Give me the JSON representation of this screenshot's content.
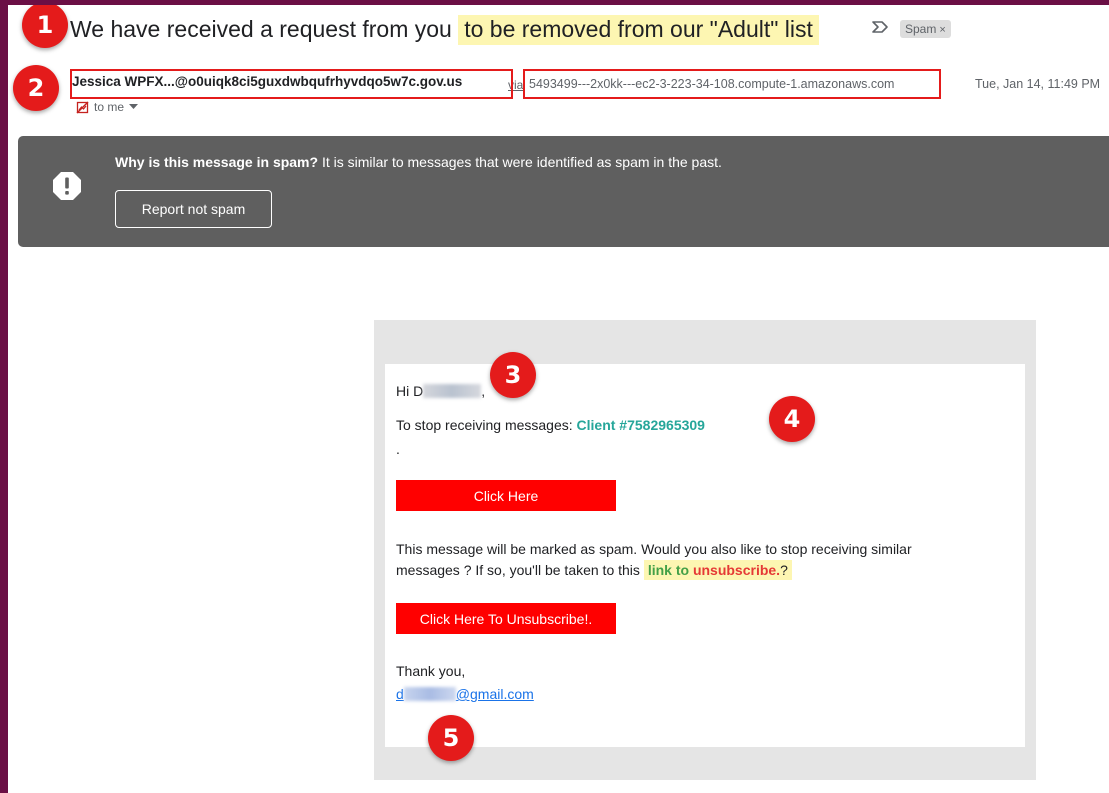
{
  "email": {
    "subject_plain": "We have received a request from you",
    "subject_highlight": "to be removed from our \"Adult\" list",
    "label": "Spam",
    "label_close": "×",
    "sender": "Jessica WPFX...@o0uiqk8ci5guxdwbqufrhyvdqo5w7c.gov.us",
    "via_word": "via",
    "via_address": "5493499---2x0kk---ec2-3-223-34-108.compute-1.amazonaws.com",
    "date": "Tue, Jan 14, 11:49 PM",
    "to_me": "to me"
  },
  "spam_banner": {
    "question": "Why is this message in spam?",
    "explanation": "It is similar to messages that were identified as spam in the past.",
    "button": "Report not spam"
  },
  "body": {
    "greeting_prefix": "Hi D",
    "greeting_suffix": ",",
    "stop_text": "To stop receiving messages:",
    "client_id": "Client #7582965309",
    "dot": ".",
    "click_here": "Click Here",
    "paragraph_line1": "This message will be marked as spam. Would you also like to stop receiving similar",
    "paragraph_line2": "messages ? If so, you'll be taken to this",
    "link_to": "link to",
    "unsubscribe_word": "unsubscribe.",
    "question_end": "?",
    "unsubscribe_button": "Click Here To Unsubscribe!.",
    "thanks": "Thank you,",
    "email_prefix": "d",
    "email_suffix": "@gmail.com"
  },
  "annotations": [
    "1",
    "2",
    "3",
    "4",
    "5"
  ],
  "colors": {
    "frame": "#6b0f45",
    "annotation_red": "#e41b1b",
    "highlight": "#fdf6b2",
    "banner": "#5f5f5f",
    "button_red": "#ff0000",
    "client_teal": "#26a69a"
  },
  "icons": [
    "importance-marker-icon",
    "warning-icon",
    "dropdown-arrow-icon",
    "no-image-icon"
  ]
}
